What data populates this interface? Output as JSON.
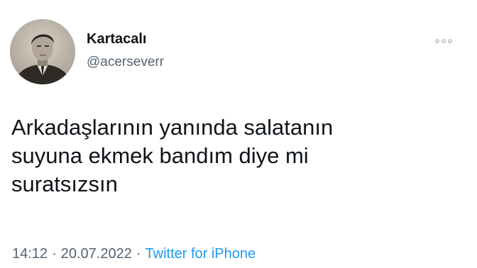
{
  "tweet": {
    "author": {
      "display_name": "Kartacalı",
      "handle": "@acerseverr"
    },
    "text": "Arkadaşlarının yanında salatanın\nsuyuna ekmek bandım diye mi\nsuratsızsın",
    "time": "14:12",
    "separator": "·",
    "date": "20.07.2022",
    "source": "Twitter for iPhone",
    "icons": {
      "more": "more-options-icon",
      "avatar": "profile-photo"
    },
    "colors": {
      "text": "#0f1419",
      "secondary": "#536471",
      "link": "#1d9bf0"
    }
  }
}
